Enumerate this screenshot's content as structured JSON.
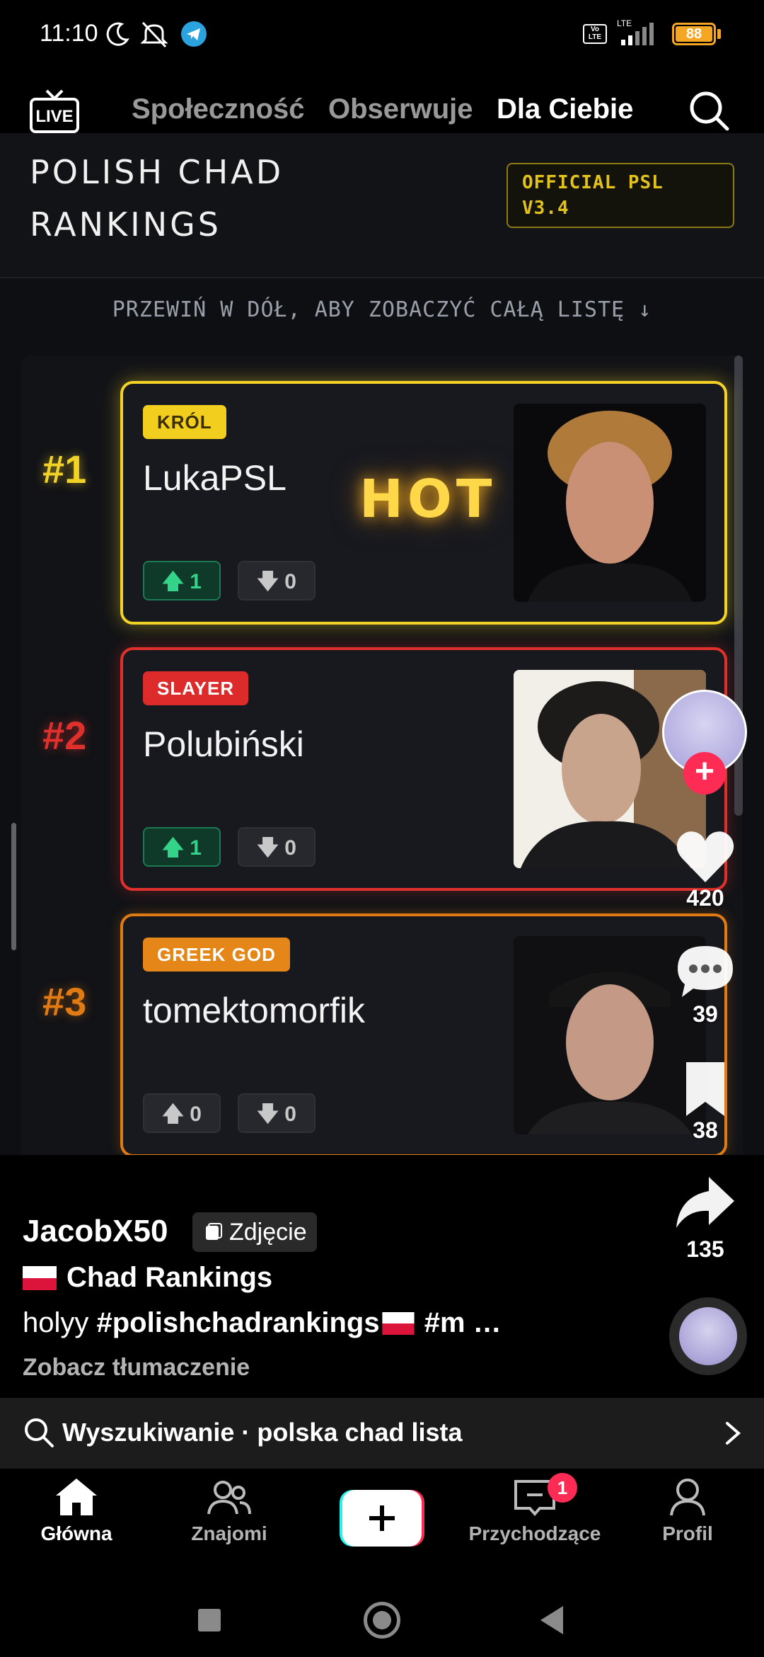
{
  "status_bar": {
    "time": "11:10",
    "network": "LTE",
    "volte": "Vo LTE",
    "battery": "88",
    "icons": [
      "moon-icon",
      "mute-icon",
      "telegram-icon",
      "signal-icon",
      "battery-icon"
    ]
  },
  "top_nav": {
    "live_label": "LIVE",
    "tabs": [
      {
        "label": "Społeczność",
        "active": false
      },
      {
        "label": "Obserwuje",
        "active": false
      },
      {
        "label": "Dla Ciebie",
        "active": true
      }
    ]
  },
  "post_image": {
    "title_line1": "POLISH CHAD",
    "title_line2": "RANKINGS",
    "badge_line1": "OFFICIAL PSL",
    "badge_line2": "V3.4",
    "scroll_hint": "PRZEWIŃ W DÓŁ, ABY ZOBACZYĆ CAŁĄ LISTĘ ↓",
    "hot_label": "HOT",
    "entries": [
      {
        "rank": "#1",
        "tag": "KRÓL",
        "name": "LukaPSL",
        "up": "1",
        "down": "0",
        "color": "#f2d226"
      },
      {
        "rank": "#2",
        "tag": "SLAYER",
        "name": "Polubiński",
        "up": "1",
        "down": "0",
        "color": "#e0302c"
      },
      {
        "rank": "#3",
        "tag": "GREEK GOD",
        "name": "tomektomorfik",
        "up": "0",
        "down": "0",
        "color": "#e07a12"
      }
    ]
  },
  "actions": {
    "likes": "420",
    "comments": "39",
    "saves": "38",
    "shares": "135"
  },
  "caption": {
    "author": "JacobX50",
    "type_chip": "Zdjęcie",
    "title": "Chad Rankings",
    "desc_prefix": "holyy ",
    "desc_hashtag1": "#polishchadrankings",
    "desc_hashtag2": " #m …",
    "translate": "Zobacz tłumaczenie"
  },
  "search_bar": {
    "text": "Wyszukiwanie · polska chad lista"
  },
  "bottom_nav": {
    "items": [
      {
        "label": "Główna",
        "active": true
      },
      {
        "label": "Znajomi",
        "active": false
      },
      {
        "label": "Przychodzące",
        "active": false
      },
      {
        "label": "Profil",
        "active": false
      }
    ],
    "inbox_badge": "1"
  },
  "colors": {
    "accent": "#fe2c55",
    "gold": "#f2d226",
    "red": "#e0302c",
    "orange": "#e07a12",
    "upvote": "#33d38a"
  }
}
